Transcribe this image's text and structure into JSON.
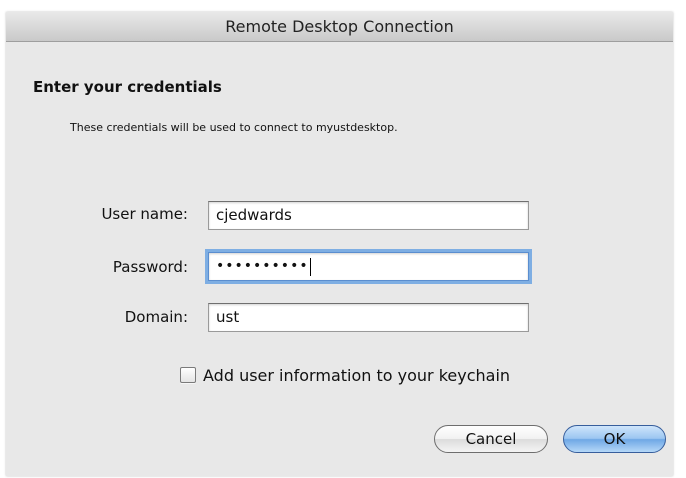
{
  "window": {
    "title": "Remote Desktop Connection"
  },
  "dialog": {
    "heading": "Enter your credentials",
    "subtext": "These credentials will be used to connect to myustdesktop."
  },
  "fields": {
    "username": {
      "label": "User name:",
      "value": "cjedwards"
    },
    "password": {
      "label": "Password:",
      "value": "••••••••••"
    },
    "domain": {
      "label": "Domain:",
      "value": "ust"
    }
  },
  "keychain": {
    "label": "Add user information to your keychain",
    "checked": false
  },
  "buttons": {
    "cancel": "Cancel",
    "ok": "OK"
  }
}
